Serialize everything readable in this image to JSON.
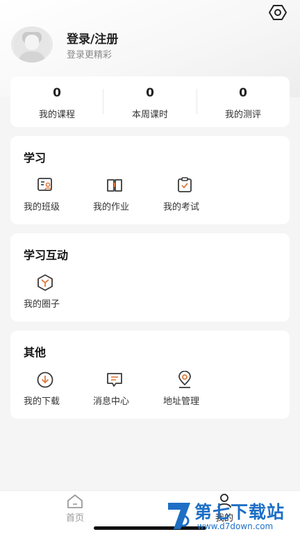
{
  "profile": {
    "login_title": "登录/注册",
    "login_subtitle": "登录更精彩"
  },
  "stats": [
    {
      "value": "0",
      "label": "我的课程"
    },
    {
      "value": "0",
      "label": "本周课时"
    },
    {
      "value": "0",
      "label": "我的测评"
    }
  ],
  "sections": {
    "study": {
      "title": "学习",
      "items": [
        {
          "label": "我的班级",
          "icon": "class-icon"
        },
        {
          "label": "我的作业",
          "icon": "book-icon"
        },
        {
          "label": "我的考试",
          "icon": "clipboard-check-icon"
        }
      ]
    },
    "interaction": {
      "title": "学习互动",
      "items": [
        {
          "label": "我的圈子",
          "icon": "circle-hexagon-icon"
        }
      ]
    },
    "other": {
      "title": "其他",
      "items": [
        {
          "label": "我的下载",
          "icon": "download-icon"
        },
        {
          "label": "消息中心",
          "icon": "message-icon"
        },
        {
          "label": "地址管理",
          "icon": "location-icon"
        }
      ]
    }
  },
  "tabbar": {
    "home": "首页",
    "mine": "我的"
  },
  "watermark": {
    "text": "第七下载站",
    "url": "www.d7down.com"
  },
  "colors": {
    "accent": "#e07a3c",
    "icon_stroke": "#3a3a3a",
    "watermark": "#1e6fc5"
  }
}
